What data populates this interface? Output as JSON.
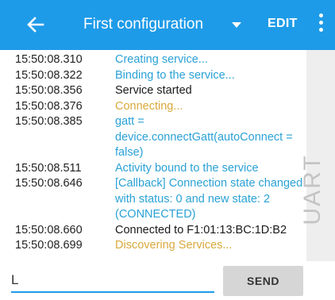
{
  "appbar": {
    "title": "First configuration",
    "edit_label": "EDIT",
    "back_icon": "arrow-left-icon",
    "dropdown_icon": "triangle-down-icon",
    "overflow_icon": "more-vertical-icon",
    "color": "#1e9be8"
  },
  "log": {
    "colors": {
      "blue": "#2aa1d6",
      "black": "#1a1a1a",
      "yellow": "#d9a93c"
    },
    "entries": [
      {
        "time": "15:50:08.310",
        "message": "Creating service...",
        "level": "blue"
      },
      {
        "time": "15:50:08.322",
        "message": "Binding to the service...",
        "level": "blue"
      },
      {
        "time": "15:50:08.356",
        "message": "Service started",
        "level": "black"
      },
      {
        "time": "15:50:08.376",
        "message": "Connecting...",
        "level": "yellow"
      },
      {
        "time": "15:50:08.385",
        "message": "gatt = device.connectGatt(autoConnect = false)",
        "level": "blue"
      },
      {
        "time": "15:50:08.511",
        "message": "Activity bound to the service",
        "level": "blue"
      },
      {
        "time": "15:50:08.646",
        "message": "[Callback] Connection state changed with status: 0 and new state: 2 (CONNECTED)",
        "level": "blue"
      },
      {
        "time": "15:50:08.660",
        "message": "Connected to F1:01:13:BC:1D:B2",
        "level": "black"
      },
      {
        "time": "15:50:08.699",
        "message": "Discovering Services...",
        "level": "yellow"
      }
    ]
  },
  "side_panel": {
    "label": "UART"
  },
  "input_bar": {
    "value": "L",
    "send_label": "SEND"
  }
}
